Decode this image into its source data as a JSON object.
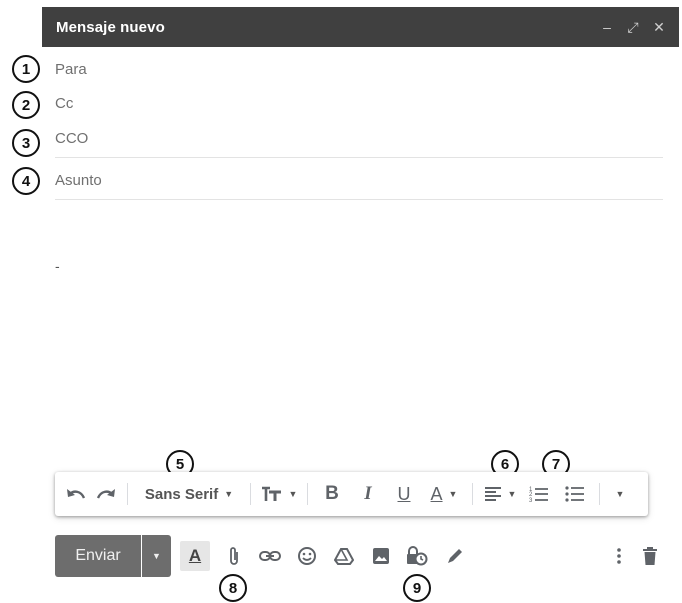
{
  "window": {
    "title": "Mensaje nuevo",
    "controls": [
      "minimize-icon",
      "expand-icon",
      "close-icon"
    ]
  },
  "fields": {
    "to_label": "Para",
    "cc_label": "Cc",
    "bcc_label": "CCO",
    "subject_placeholder": "Asunto"
  },
  "body": {
    "signature": "-"
  },
  "toolbar": {
    "font": "Sans Serif",
    "icons": [
      "undo-icon",
      "redo-icon",
      "font-size-icon",
      "bold-icon",
      "italic-icon",
      "underline-icon",
      "text-color-icon",
      "align-icon",
      "numbered-list-icon",
      "bulleted-list-icon",
      "more-formatting-icon"
    ],
    "bold": "B",
    "italic": "I",
    "underline": "U",
    "text_color": "A"
  },
  "bottom": {
    "send_label": "Enviar",
    "format_label": "A",
    "icons": [
      "formatting-icon",
      "attach-icon",
      "link-icon",
      "emoji-icon",
      "drive-icon",
      "photo-icon",
      "confidential-mode-icon",
      "signature-icon",
      "more-options-icon",
      "trash-icon"
    ]
  },
  "callouts": [
    "1",
    "2",
    "3",
    "4",
    "5",
    "6",
    "7",
    "8",
    "9"
  ]
}
